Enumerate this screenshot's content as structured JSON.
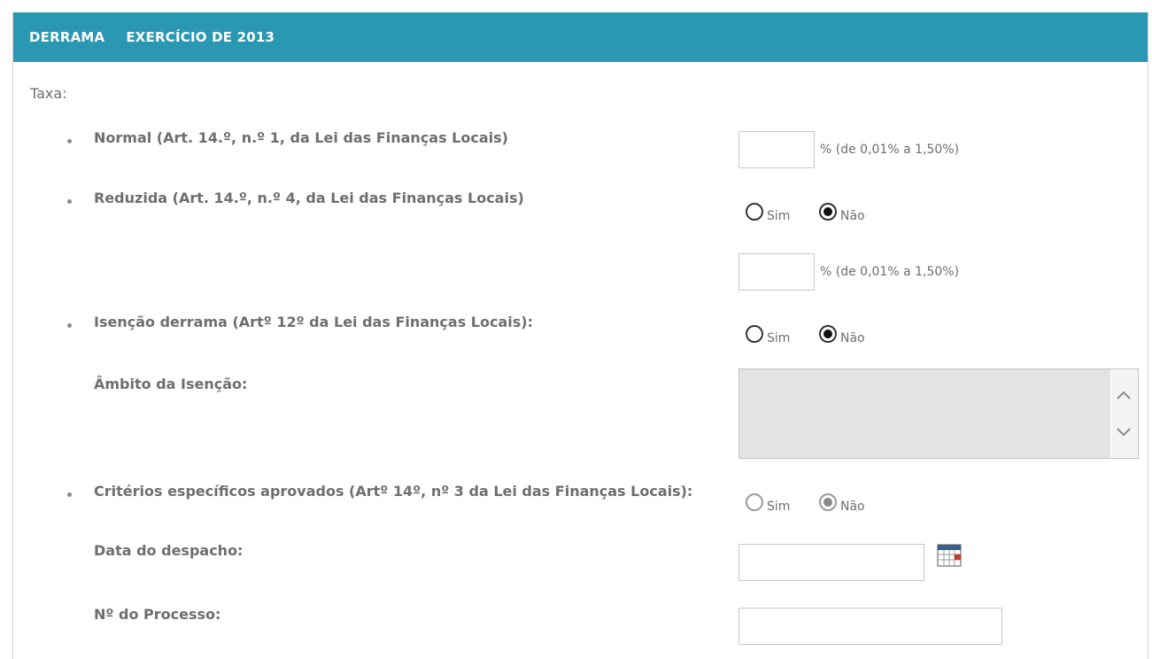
{
  "header": {
    "title": "DERRAMA",
    "subtitle": "EXERCÍCIO DE 2013"
  },
  "taxa_label": "Taxa:",
  "normal": {
    "label": "Normal (Art. 14.º, n.º 1, da Lei das Finanças Locais)",
    "value": "",
    "hint": "% (de 0,01% a 1,50%)"
  },
  "reduzida": {
    "label": "Reduzida (Art. 14.º, n.º 4, da Lei das Finanças Locais)",
    "sim": "Sim",
    "nao": "Não",
    "selected": "Não",
    "value": "",
    "hint": "% (de 0,01% a 1,50%)"
  },
  "isencao": {
    "label": "Isenção derrama (Artº 12º da Lei das Finanças Locais):",
    "sim": "Sim",
    "nao": "Não",
    "selected": "Não",
    "ambito_label": "Âmbito da Isenção:",
    "ambito_value": ""
  },
  "criterios": {
    "label": "Critérios específicos aprovados (Artº 14º, nº 3 da Lei das Finanças Locais):",
    "sim": "Sim",
    "nao": "Não",
    "selected": "Não",
    "data_label": "Data do despacho:",
    "data_value": "",
    "processo_label": "Nº do Processo:",
    "processo_value": ""
  },
  "colors": {
    "header_bg": "#2a98b2",
    "text": "#6e6e6e"
  },
  "icons": {
    "calendar": "calendar-icon",
    "scroll_up": "chevron-up-icon",
    "scroll_down": "chevron-down-icon"
  }
}
